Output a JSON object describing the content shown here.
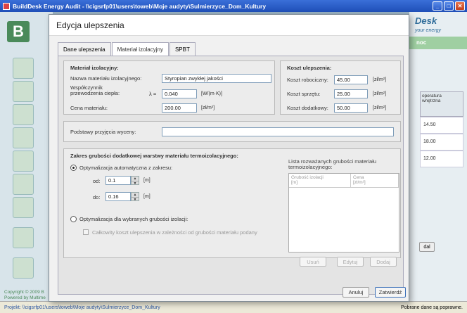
{
  "window": {
    "title": "BuildDesk Energy Audit - \\\\cigsrfp01\\users\\toweb\\Moje audyty\\Sulmierzyce_Dom_Kultury"
  },
  "background": {
    "brand": "Desk",
    "brand_sub": "your energy",
    "green_bar": "noc",
    "table_header": "operatura\nwnętrzna",
    "table_values": [
      "14.50",
      "18.00",
      "12.00"
    ],
    "side_button": "dal",
    "copyright": "Copyright © 2009 B\nPowered by Multime"
  },
  "statusbar": {
    "project": "Projekt: \\\\cigsrfp01\\users\\toweb\\Moje audyty\\Sulmierzyce_Dom_Kultury",
    "status": "Pobrane dane są poprawne."
  },
  "dialog": {
    "title": "Edycja ulepszenia",
    "tabs": [
      "Dane ulepszenia",
      "Materiał izolacyjny",
      "SPBT"
    ],
    "material": {
      "group_title": "Materiał izolacyjny:",
      "name_label": "Nazwa materiału izolacyjnego:",
      "name_value": "Styropian zwykłej jakości",
      "lambda_label": "Współczynnik przewodzenia ciepła:",
      "lambda_symbol": "λ =",
      "lambda_value": "0.040",
      "lambda_unit": "[W/(m·K)]",
      "price_label": "Cena materiału:",
      "price_value": "200.00",
      "price_unit": "[zł/m³]"
    },
    "cost": {
      "group_title": "Koszt ulepszenia:",
      "labor_label": "Koszt robociczny:",
      "labor_value": "45.00",
      "equipment_label": "Koszt sprzętu:",
      "equipment_value": "25.00",
      "extra_label": "Koszt dodatkowy:",
      "extra_value": "50.00",
      "unit": "[zł/m²]"
    },
    "basis": {
      "label": "Podstawy przyjęcia wyceny:",
      "value": ""
    },
    "thickness": {
      "group_title": "Zakres grubości dodatkowej warstwy materiału termoizolacyjnego:",
      "auto_label": "Optymalizacja automatyczna z zakresu:",
      "from_label": "od:",
      "from_value": "0.1",
      "to_label": "do:",
      "to_value": "0.16",
      "unit": "[m]",
      "selected_label": "Optymalizacja dla wybranych grubości izolacji:",
      "total_cost_label": "Całkowity koszt ulepszenia w zależności od grubości materiału podany",
      "list_title": "Lista rozważanych grubości materiału termoizolacyjnego:",
      "list_col1": "Grubość izolacji\n[m]",
      "list_col2": "Cena\n[zł/m²]",
      "remove": "Usuń",
      "edit": "Edytuj",
      "add": "Dodaj"
    },
    "cancel": "Anuluj",
    "confirm": "Zatwierdź"
  }
}
